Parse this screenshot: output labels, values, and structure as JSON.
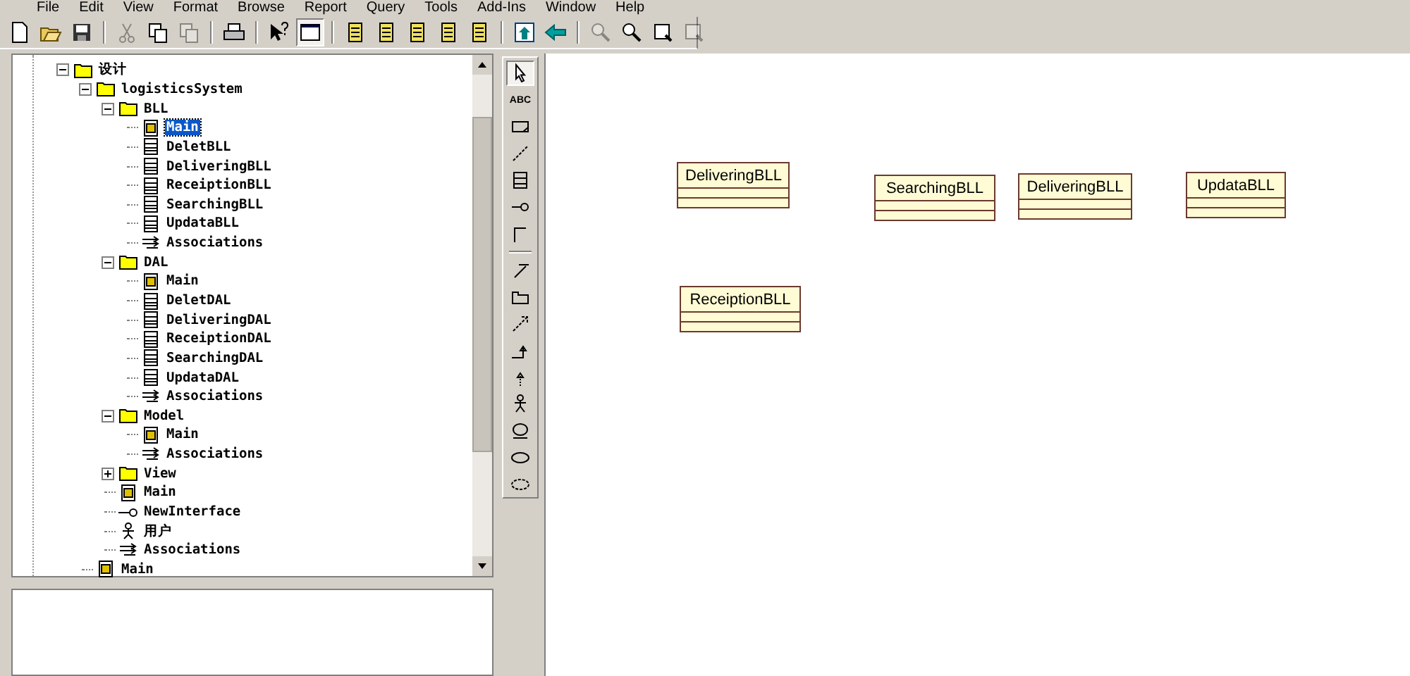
{
  "menu": [
    "File",
    "Edit",
    "View",
    "Format",
    "Browse",
    "Report",
    "Query",
    "Tools",
    "Add-Ins",
    "Window",
    "Help"
  ],
  "toolbar": [
    {
      "kind": "new",
      "disabled": false,
      "pressed": false
    },
    {
      "kind": "open",
      "disabled": false,
      "pressed": false
    },
    {
      "kind": "save",
      "disabled": false,
      "pressed": false
    },
    {
      "kind": "separator"
    },
    {
      "kind": "cut",
      "disabled": true,
      "pressed": false
    },
    {
      "kind": "copy",
      "disabled": false,
      "pressed": false
    },
    {
      "kind": "paste",
      "disabled": true,
      "pressed": false
    },
    {
      "kind": "separator"
    },
    {
      "kind": "print",
      "disabled": false,
      "pressed": false
    },
    {
      "kind": "separator"
    },
    {
      "kind": "help",
      "disabled": false,
      "pressed": false
    },
    {
      "kind": "window",
      "disabled": false,
      "pressed": true
    },
    {
      "kind": "separator"
    },
    {
      "kind": "doc",
      "disabled": false,
      "pressed": false
    },
    {
      "kind": "doc",
      "disabled": false,
      "pressed": false
    },
    {
      "kind": "doc",
      "disabled": false,
      "pressed": false
    },
    {
      "kind": "doc",
      "disabled": false,
      "pressed": false
    },
    {
      "kind": "doc",
      "disabled": false,
      "pressed": false
    },
    {
      "kind": "separator"
    },
    {
      "kind": "up",
      "disabled": false,
      "pressed": false
    },
    {
      "kind": "back",
      "disabled": false,
      "pressed": false
    },
    {
      "kind": "separator"
    },
    {
      "kind": "zoomin",
      "disabled": true,
      "pressed": false
    },
    {
      "kind": "zoomout",
      "disabled": false,
      "pressed": false
    },
    {
      "kind": "fit",
      "disabled": false,
      "pressed": false
    },
    {
      "kind": "fit",
      "disabled": true,
      "pressed": false
    }
  ],
  "tree": [
    {
      "kind": "folder",
      "label": "设计",
      "expanded": true,
      "selected": false,
      "children": [
        {
          "kind": "folder",
          "label": "logisticsSystem",
          "expanded": true,
          "selected": false,
          "children": [
            {
              "kind": "folder",
              "label": "BLL",
              "expanded": true,
              "selected": false,
              "children": [
                {
                  "kind": "diagram",
                  "label": "Main",
                  "selected": true
                },
                {
                  "kind": "class",
                  "label": "DeletBLL",
                  "selected": false
                },
                {
                  "kind": "class",
                  "label": "DeliveringBLL",
                  "selected": false
                },
                {
                  "kind": "class",
                  "label": "ReceiptionBLL",
                  "selected": false
                },
                {
                  "kind": "class",
                  "label": "SearchingBLL",
                  "selected": false
                },
                {
                  "kind": "class",
                  "label": "UpdataBLL",
                  "selected": false
                },
                {
                  "kind": "associations",
                  "label": "Associations",
                  "selected": false
                }
              ]
            },
            {
              "kind": "folder",
              "label": "DAL",
              "expanded": true,
              "selected": false,
              "children": [
                {
                  "kind": "diagram",
                  "label": "Main",
                  "selected": false
                },
                {
                  "kind": "class",
                  "label": "DeletDAL",
                  "selected": false
                },
                {
                  "kind": "class",
                  "label": "DeliveringDAL",
                  "selected": false
                },
                {
                  "kind": "class",
                  "label": "ReceiptionDAL",
                  "selected": false
                },
                {
                  "kind": "class",
                  "label": "SearchingDAL",
                  "selected": false
                },
                {
                  "kind": "class",
                  "label": "UpdataDAL",
                  "selected": false
                },
                {
                  "kind": "associations",
                  "label": "Associations",
                  "selected": false
                }
              ]
            },
            {
              "kind": "folder",
              "label": "Model",
              "expanded": true,
              "selected": false,
              "children": [
                {
                  "kind": "diagram",
                  "label": "Main",
                  "selected": false
                },
                {
                  "kind": "associations",
                  "label": "Associations",
                  "selected": false
                }
              ]
            },
            {
              "kind": "folder",
              "label": "View",
              "expanded": false,
              "selected": false
            },
            {
              "kind": "diagram",
              "label": "Main",
              "selected": false
            },
            {
              "kind": "interface",
              "label": "NewInterface",
              "selected": false
            },
            {
              "kind": "actor",
              "label": "用户",
              "selected": false
            },
            {
              "kind": "associations",
              "label": "Associations",
              "selected": false
            }
          ]
        },
        {
          "kind": "diagram",
          "label": "Main",
          "selected": false
        }
      ]
    }
  ],
  "palette": [
    {
      "kind": "pointer",
      "selected": true
    },
    {
      "kind": "text",
      "label": "ABC",
      "selected": false
    },
    {
      "kind": "note",
      "selected": false
    },
    {
      "kind": "anchor",
      "selected": false
    },
    {
      "kind": "class",
      "selected": false
    },
    {
      "kind": "interface",
      "selected": false
    },
    {
      "kind": "association",
      "selected": false
    },
    {
      "kind": "separator"
    },
    {
      "kind": "unidirectional",
      "selected": false
    },
    {
      "kind": "package",
      "selected": false
    },
    {
      "kind": "dependency",
      "selected": false
    },
    {
      "kind": "generalization",
      "selected": false
    },
    {
      "kind": "realize",
      "selected": false
    },
    {
      "kind": "actor",
      "selected": false
    },
    {
      "kind": "usecase-interface",
      "selected": false
    },
    {
      "kind": "usecase",
      "selected": false
    },
    {
      "kind": "dashed-usecase",
      "selected": false
    }
  ],
  "diagram": {
    "classes": [
      {
        "name": "DeliveringBLL"
      },
      {
        "name": "SearchingBLL"
      },
      {
        "name": "DeliveringBLL"
      },
      {
        "name": "UpdataBLL"
      },
      {
        "name": "ReceiptionBLL"
      }
    ]
  }
}
